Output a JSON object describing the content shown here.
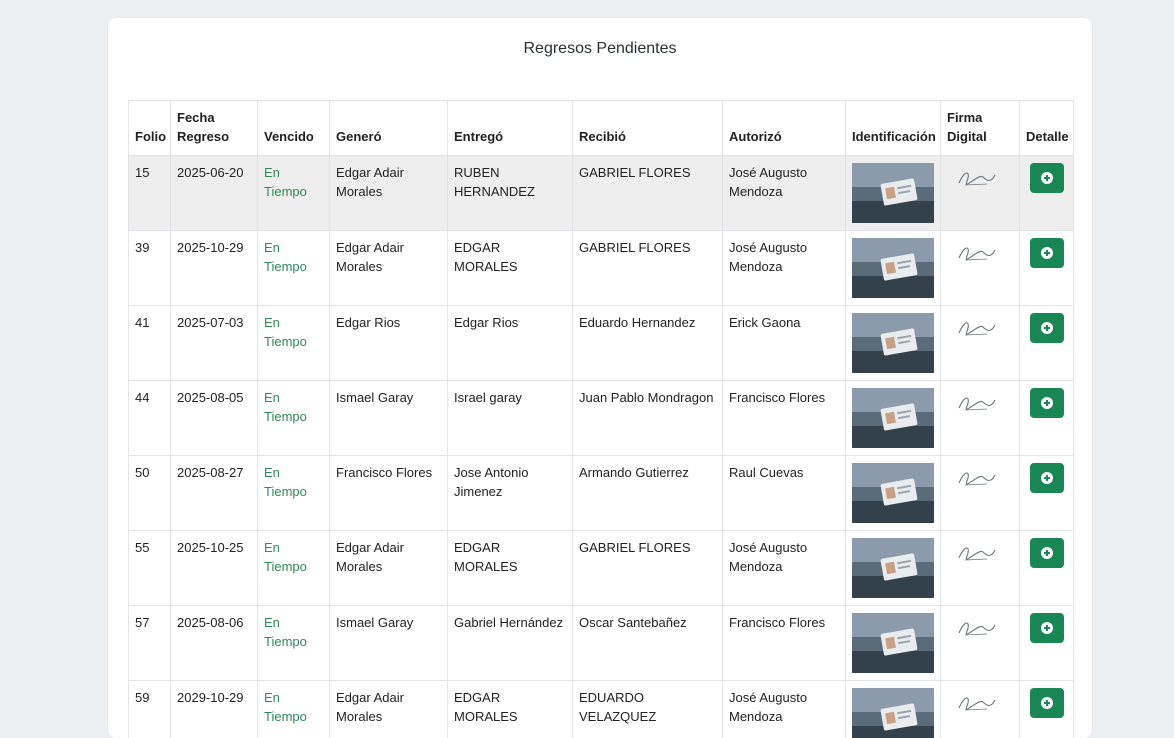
{
  "title": "Regresos Pendientes",
  "colors": {
    "accent": "#198754",
    "status_ok": "#2e8b57"
  },
  "columns": [
    {
      "top": "",
      "bottom": "Folio"
    },
    {
      "top": "Fecha",
      "bottom": "Regreso"
    },
    {
      "top": "",
      "bottom": "Vencido"
    },
    {
      "top": "",
      "bottom": "Generó"
    },
    {
      "top": "",
      "bottom": "Entregó"
    },
    {
      "top": "",
      "bottom": "Recibió"
    },
    {
      "top": "",
      "bottom": "Autorizó"
    },
    {
      "top": "",
      "bottom": "Identificación"
    },
    {
      "top": "Firma",
      "bottom": "Digital"
    },
    {
      "top": "",
      "bottom": "Detalle"
    }
  ],
  "rows": [
    {
      "folio": "15",
      "fecha": "2025-06-20",
      "vencido_a": "En",
      "vencido_b": "Tiempo",
      "genero": "Edgar Adair Morales",
      "entrego": "RUBEN HERNANDEZ",
      "recibio": "GABRIEL FLORES",
      "autorizo": "José Augusto Mendoza",
      "id_icon": "id-photo-icon",
      "sig_icon": "signature-icon",
      "detail_icon": "plus-circle-icon"
    },
    {
      "folio": "39",
      "fecha": "2025-10-29",
      "vencido_a": "En",
      "vencido_b": "Tiempo",
      "genero": "Edgar Adair Morales",
      "entrego": "EDGAR MORALES",
      "recibio": "GABRIEL FLORES",
      "autorizo": "José Augusto Mendoza",
      "id_icon": "id-photo-icon",
      "sig_icon": "signature-icon",
      "detail_icon": "plus-circle-icon"
    },
    {
      "folio": "41",
      "fecha": "2025-07-03",
      "vencido_a": "En",
      "vencido_b": "Tiempo",
      "genero": "Edgar Rios",
      "entrego": "Edgar Rios",
      "recibio": "Eduardo Hernandez",
      "autorizo": "Erick Gaona",
      "id_icon": "id-photo-icon",
      "sig_icon": "signature-icon",
      "detail_icon": "plus-circle-icon"
    },
    {
      "folio": "44",
      "fecha": "2025-08-05",
      "vencido_a": "En",
      "vencido_b": "Tiempo",
      "genero": "Ismael Garay",
      "entrego": "Israel garay",
      "recibio": "Juan Pablo Mondragon",
      "autorizo": "Francisco Flores",
      "id_icon": "id-photo-icon",
      "sig_icon": "signature-icon",
      "detail_icon": "plus-circle-icon"
    },
    {
      "folio": "50",
      "fecha": "2025-08-27",
      "vencido_a": "En",
      "vencido_b": "Tiempo",
      "genero": "Francisco Flores",
      "entrego": "Jose Antonio Jimenez",
      "recibio": "Armando Gutierrez",
      "autorizo": "Raul Cuevas",
      "id_icon": "id-photo-icon",
      "sig_icon": "signature-icon",
      "detail_icon": "plus-circle-icon"
    },
    {
      "folio": "55",
      "fecha": "2025-10-25",
      "vencido_a": "En",
      "vencido_b": "Tiempo",
      "genero": "Edgar Adair Morales",
      "entrego": "EDGAR MORALES",
      "recibio": "GABRIEL FLORES",
      "autorizo": "José Augusto Mendoza",
      "id_icon": "id-photo-icon",
      "sig_icon": "signature-icon",
      "detail_icon": "plus-circle-icon"
    },
    {
      "folio": "57",
      "fecha": "2025-08-06",
      "vencido_a": "En",
      "vencido_b": "Tiempo",
      "genero": "Ismael Garay",
      "entrego": "Gabriel Hernández",
      "recibio": "Oscar Santebañez",
      "autorizo": "Francisco Flores",
      "id_icon": "id-photo-icon",
      "sig_icon": "signature-icon",
      "detail_icon": "plus-circle-icon"
    },
    {
      "folio": "59",
      "fecha": "2029-10-29",
      "vencido_a": "En",
      "vencido_b": "Tiempo",
      "genero": "Edgar Adair Morales",
      "entrego": "EDGAR MORALES",
      "recibio": "EDUARDO VELAZQUEZ",
      "autorizo": "José Augusto Mendoza",
      "id_icon": "id-photo-icon",
      "sig_icon": "signature-icon",
      "detail_icon": "plus-circle-icon"
    }
  ]
}
